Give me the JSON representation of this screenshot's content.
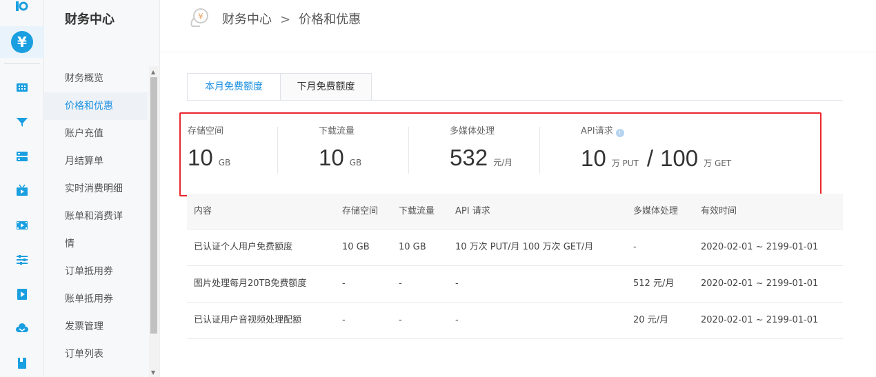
{
  "sidebar": {
    "rail_icons": [
      "logo-icon",
      "yuan-icon",
      "grid-icon",
      "filter-icon",
      "server-icon",
      "tv-icon",
      "video-icon",
      "sliders-icon",
      "play-file-icon",
      "cloud-icon",
      "book-icon"
    ],
    "title": "财务中心",
    "items": [
      {
        "label": "财务概览"
      },
      {
        "label": "价格和优惠"
      },
      {
        "label": "账户充值"
      },
      {
        "label": "月结算单"
      },
      {
        "label": "实时消费明细"
      },
      {
        "label": "账单和消费详"
      },
      {
        "label": "情"
      },
      {
        "label": "订单抵用券"
      },
      {
        "label": "账单抵用券"
      },
      {
        "label": "发票管理"
      },
      {
        "label": "订单列表"
      }
    ]
  },
  "header": {
    "crumb_root": "财务中心",
    "crumb_sep": ">",
    "crumb_current": "价格和优惠"
  },
  "tabs": [
    {
      "label": "本月免费额度"
    },
    {
      "label": "下月免费额度"
    }
  ],
  "summary": {
    "storage": {
      "label": "存储空间",
      "value": "10",
      "unit": "GB"
    },
    "download": {
      "label": "下载流量",
      "value": "10",
      "unit": "GB"
    },
    "media": {
      "label": "多媒体处理",
      "value": "532",
      "unit": "元/月"
    },
    "api": {
      "label": "API请求",
      "info": "i",
      "put_value": "10",
      "put_unit": "万 PUT",
      "slash": "/",
      "get_value": "100",
      "get_unit": "万 GET"
    }
  },
  "table": {
    "headers": [
      "内容",
      "存储空间",
      "下载流量",
      "API 请求",
      "多媒体处理",
      "有效时间"
    ],
    "rows": [
      [
        "已认证个人用户免费额度",
        "10 GB",
        "10 GB",
        "10 万次 PUT/月 100 万次 GET/月",
        "-",
        "2020-02-01 ~ 2199-01-01"
      ],
      [
        "图片处理每月20TB免费额度",
        "-",
        "-",
        "-",
        "512 元/月",
        "2020-02-01 ~ 2199-01-01"
      ],
      [
        "已认证用户音视频处理配额",
        "-",
        "-",
        "-",
        "20 元/月",
        "2020-02-01 ~ 2199-01-01"
      ]
    ]
  },
  "colors": {
    "accent": "#1a8fe0",
    "highlight_border": "#e8262c"
  }
}
